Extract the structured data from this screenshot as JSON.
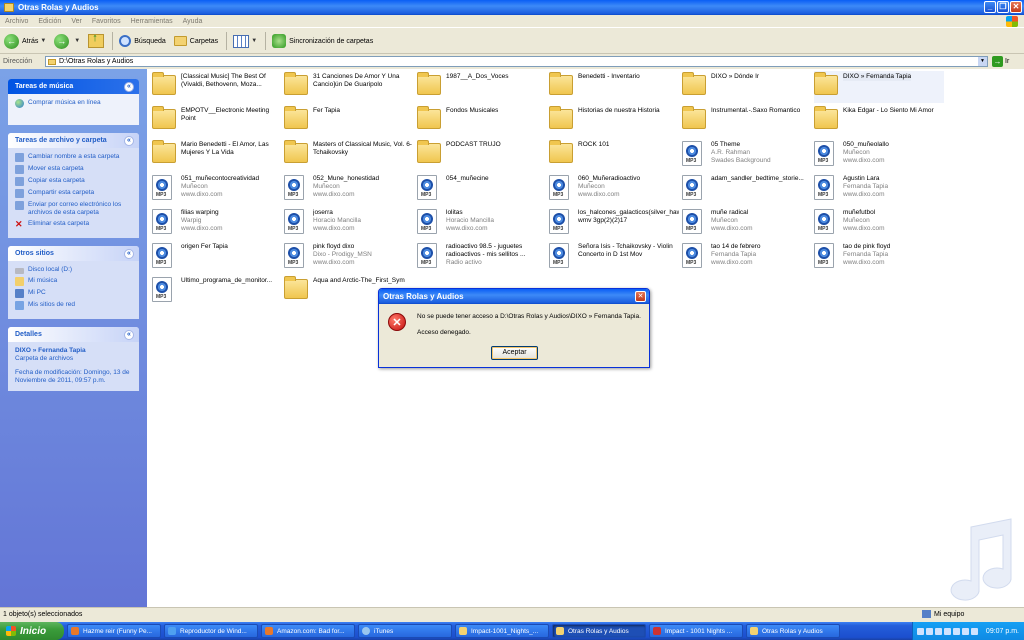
{
  "window": {
    "title": "Otras Rolas y Audios"
  },
  "menu": [
    "Archivo",
    "Edición",
    "Ver",
    "Favoritos",
    "Herramientas",
    "Ayuda"
  ],
  "toolbar": {
    "back": "Atrás",
    "search": "Búsqueda",
    "folders": "Carpetas",
    "sync": "Sincronización de carpetas"
  },
  "address": {
    "label": "Dirección",
    "path": "D:\\Otras Rolas y Audios",
    "go": "Ir"
  },
  "panels": {
    "music": {
      "title": "Tareas de música",
      "items": [
        "Comprar música en línea"
      ]
    },
    "file_tasks": {
      "title": "Tareas de archivo y carpeta",
      "items": [
        "Cambiar nombre a esta carpeta",
        "Mover esta carpeta",
        "Copiar esta carpeta",
        "Compartir esta carpeta",
        "Enviar por correo electrónico los archivos de esta carpeta",
        "Eliminar esta carpeta"
      ]
    },
    "places": {
      "title": "Otros sitios",
      "items": [
        "Disco local (D:)",
        "Mi música",
        "Mi PC",
        "Mis sitios de red"
      ]
    },
    "details": {
      "title": "Detalles",
      "name": "DIXO » Fernanda Tapia",
      "type": "Carpeta de archivos",
      "modified": "Fecha de modificación: Domingo, 13 de Noviembre de 2011, 09:57 p.m."
    }
  },
  "files": [
    {
      "kind": "folder",
      "name": "[Classical Music] The Best Of (Vivaldi, Bethovenn, Moza...",
      "l2": "",
      "l3": ""
    },
    {
      "kind": "folder",
      "name": "31 Canciones De Amor Y Una Cancio]ún De Guaripolo",
      "l2": "",
      "l3": ""
    },
    {
      "kind": "folder",
      "name": "1987__A_Dos_Voces",
      "l2": "",
      "l3": ""
    },
    {
      "kind": "folder",
      "name": "Benedetti - Inventario",
      "l2": "",
      "l3": ""
    },
    {
      "kind": "folder",
      "name": "DIXO » Dónde Ir",
      "l2": "",
      "l3": ""
    },
    {
      "kind": "folder",
      "name": "DIXO » Fernanda Tapia",
      "l2": "",
      "l3": ""
    },
    {
      "kind": "folder",
      "name": "EMPOTV__Electronic Meeting Point",
      "l2": "",
      "l3": ""
    },
    {
      "kind": "folder",
      "name": "Fer Tapia",
      "l2": "",
      "l3": ""
    },
    {
      "kind": "folder",
      "name": "Fondos Musicales",
      "l2": "",
      "l3": ""
    },
    {
      "kind": "folder",
      "name": "Historias de nuestra Historia",
      "l2": "",
      "l3": ""
    },
    {
      "kind": "folder",
      "name": "Instrumental.-.Saxo Romantico",
      "l2": "",
      "l3": ""
    },
    {
      "kind": "folder",
      "name": "Kika Edgar - Lo Siento Mi Amor",
      "l2": "",
      "l3": ""
    },
    {
      "kind": "folder",
      "name": "Mario Benedetti - El Amor, Las Mujeres Y La Vida",
      "l2": "",
      "l3": ""
    },
    {
      "kind": "folder",
      "name": "Masters of Classical Music, Vol. 6- Tchaikovsky",
      "l2": "",
      "l3": ""
    },
    {
      "kind": "folder",
      "name": "PODCAST TRUJO",
      "l2": "",
      "l3": ""
    },
    {
      "kind": "folder",
      "name": "ROCK 101",
      "l2": "",
      "l3": ""
    },
    {
      "kind": "mp3",
      "name": "05 Theme",
      "l2": "A.R. Rahman",
      "l3": "Swades Background"
    },
    {
      "kind": "mp3",
      "name": "050_muñeolallo",
      "l2": "Muñecon",
      "l3": "www.dixo.com"
    },
    {
      "kind": "mp3",
      "name": "051_muñecontocreatividad",
      "l2": "Muñecon",
      "l3": "www.dixo.com"
    },
    {
      "kind": "mp3",
      "name": "052_Mune_honestidad",
      "l2": "Muñecon",
      "l3": "www.dixo.com"
    },
    {
      "kind": "mp3",
      "name": "054_muñecine",
      "l2": "",
      "l3": ""
    },
    {
      "kind": "mp3",
      "name": "060_Muñeradioactivo",
      "l2": "Muñecon",
      "l3": "www.dixo.com"
    },
    {
      "kind": "mp3",
      "name": "adam_sandler_bedtime_storie...",
      "l2": "",
      "l3": ""
    },
    {
      "kind": "mp3",
      "name": "Agustin Lara",
      "l2": "Fernanda Tapia",
      "l3": "www.dixo.com"
    },
    {
      "kind": "mp3",
      "name": "filias warping",
      "l2": "Warpig",
      "l3": "www.dixo.com"
    },
    {
      "kind": "mp3",
      "name": "joserra",
      "l2": "Horacio Mancilla",
      "l3": "www.dixo.com"
    },
    {
      "kind": "mp3",
      "name": "lolitas",
      "l2": "Horacio Mancilla",
      "l3": "www.dixo.com"
    },
    {
      "kind": "mp3",
      "name": "los_halcones_galacticos(silver_hawks) wmv 3gp(2)(2)17",
      "l2": "",
      "l3": ""
    },
    {
      "kind": "mp3",
      "name": "muñe radical",
      "l2": "Muñecon",
      "l3": "www.dixo.com"
    },
    {
      "kind": "mp3",
      "name": "muñefutbol",
      "l2": "Muñecon",
      "l3": "www.dixo.com"
    },
    {
      "kind": "mp3",
      "name": "origen Fer Tapia",
      "l2": "",
      "l3": ""
    },
    {
      "kind": "mp3",
      "name": "pink floyd dixo",
      "l2": "Dixo - Prodigy_MSN",
      "l3": "www.dixo.com"
    },
    {
      "kind": "mp3",
      "name": "radioactivo 98.5 - juguetes radioactivos - mis sellitos ...",
      "l2": "Radio activo",
      "l3": ""
    },
    {
      "kind": "mp3",
      "name": "Señora Isis - Tchaikovsky - Violin Concerto in D 1st Mov",
      "l2": "",
      "l3": ""
    },
    {
      "kind": "mp3",
      "name": "tao 14 de febrero",
      "l2": "Fernanda Tapia",
      "l3": "www.dixo.com"
    },
    {
      "kind": "mp3",
      "name": "tao de pink floyd",
      "l2": "Fernanda Tapia",
      "l3": "www.dixo.com"
    },
    {
      "kind": "mp3",
      "name": "Ultimo_programa_de_monitor...",
      "l2": "",
      "l3": ""
    },
    {
      "kind": "folder",
      "name": "Aqua and Arctic-The_First_Sym",
      "l2": "",
      "l3": ""
    }
  ],
  "dialog": {
    "title": "Otras Rolas y Audios",
    "message": "No se puede tener acceso a D:\\Otras Rolas y Audios\\DIXO » Fernanda Tapia.",
    "detail": "Acceso denegado.",
    "ok": "Aceptar"
  },
  "status": {
    "left": "1 objeto(s) seleccionados",
    "right": "Mi equipo"
  },
  "taskbar": {
    "start": "Inicio",
    "tasks": [
      "Hazme reir (Funny Pe...",
      "Reproductor de Wind...",
      "Amazon.com: Bad for...",
      "iTunes",
      "Impact-1001_Nights_...",
      "Otras Rolas y Audios",
      "Impact - 1001 Nights ...",
      "Otras Rolas y Audios"
    ],
    "clock": "09:07 p.m."
  },
  "colors": {
    "xp_blue": "#245edb",
    "panel_blue": "#6375d6",
    "link": "#215dc6"
  }
}
